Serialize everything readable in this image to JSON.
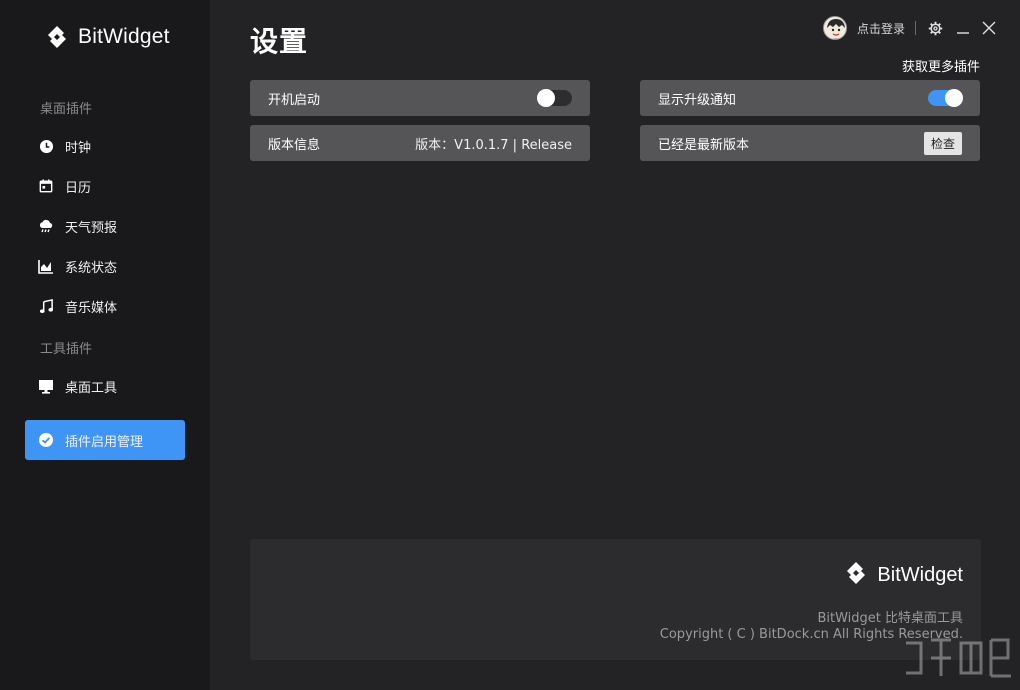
{
  "app": {
    "name": "BitWidget",
    "accent": "#3e95f5"
  },
  "sidebar": {
    "section1": "桌面插件",
    "items": [
      {
        "label": "时钟",
        "icon": "clock-icon"
      },
      {
        "label": "日历",
        "icon": "calendar-icon"
      },
      {
        "label": "天气预报",
        "icon": "weather-icon"
      },
      {
        "label": "系统状态",
        "icon": "chart-icon"
      },
      {
        "label": "音乐媒体",
        "icon": "music-icon"
      }
    ],
    "section2": "工具插件",
    "tools": [
      {
        "label": "桌面工具",
        "icon": "monitor-icon"
      }
    ],
    "manage": {
      "label": "插件启用管理",
      "icon": "check-circle-icon",
      "active": true
    }
  },
  "header": {
    "title": "设置",
    "login": "点击登录",
    "more_plugins": "获取更多插件"
  },
  "settings": {
    "autostart": {
      "label": "开机启动",
      "enabled": false
    },
    "upgrade_notify": {
      "label": "显示升级通知",
      "enabled": true
    },
    "version": {
      "label": "版本信息",
      "value": "版本：V1.0.1.7 | Release"
    },
    "latest": {
      "label": "已经是最新版本",
      "button": "检查"
    }
  },
  "footer": {
    "brand": "BitWidget",
    "tagline": "BitWidget 比特桌面工具",
    "copyright": "Copyright ( C ) BitDock.cn All Rights Reserved."
  }
}
